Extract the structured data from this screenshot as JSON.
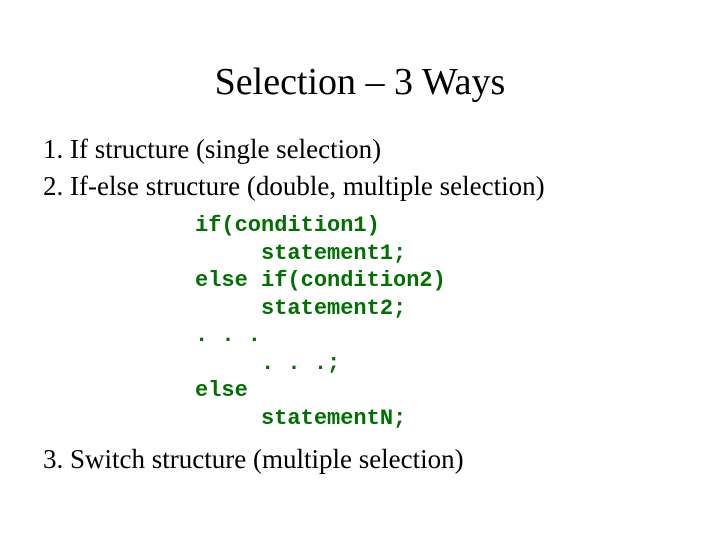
{
  "title": "Selection – 3 Ways",
  "items": {
    "one": "If structure (single selection)",
    "two": "If-else structure (double, multiple selection)",
    "three": "Switch structure (multiple selection)"
  },
  "code": "if(condition1)\n     statement1;\nelse if(condition2)\n     statement2;\n. . .\n     . . .;\nelse\n     statementN;"
}
